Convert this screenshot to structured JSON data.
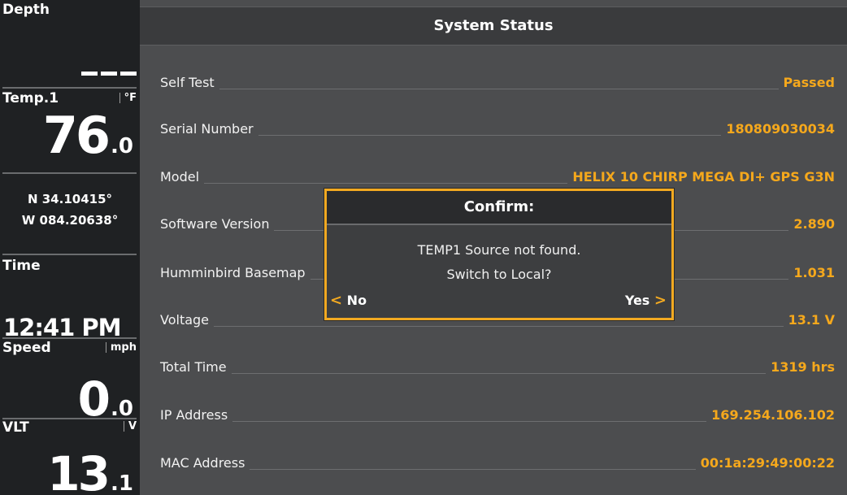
{
  "sidebar": {
    "depth": {
      "label": "Depth",
      "value": ""
    },
    "temp": {
      "label": "Temp.1",
      "unit": "°F",
      "value": "76",
      "decimal": "0"
    },
    "gps": {
      "lat": "N 34.10415°",
      "lon": "W 084.20638°"
    },
    "time": {
      "label": "Time",
      "value": "12:41 PM"
    },
    "speed": {
      "label": "Speed",
      "unit": "mph",
      "value": "0",
      "decimal": "0"
    },
    "vlt": {
      "label": "VLT",
      "unit": "V",
      "value": "13",
      "decimal": "1"
    }
  },
  "main": {
    "title": "System Status",
    "rows": [
      {
        "label": "Self Test",
        "value": "Passed"
      },
      {
        "label": "Serial Number",
        "value": "180809030034"
      },
      {
        "label": "Model",
        "value": "HELIX 10 CHIRP MEGA DI+ GPS G3N"
      },
      {
        "label": "Software Version",
        "value": "2.890"
      },
      {
        "label": "Humminbird Basemap",
        "value": "1.031"
      },
      {
        "label": "Voltage",
        "value": "13.1 V"
      },
      {
        "label": "Total Time",
        "value": "1319 hrs"
      },
      {
        "label": "IP Address",
        "value": "169.254.106.102"
      },
      {
        "label": "MAC Address",
        "value": "00:1a:29:49:00:22"
      }
    ]
  },
  "dialog": {
    "title": "Confirm:",
    "message_line1": "TEMP1 Source not found.",
    "message_line2": "Switch to Local?",
    "no_label": "No",
    "yes_label": "Yes"
  },
  "colors": {
    "accent": "#f5a81c",
    "panel_bg": "#4c4d4f",
    "sidebar_bg": "#1f2123",
    "title_bar_bg": "#3a3b3d"
  },
  "icons": {
    "no_chevron": "chevron-left-icon",
    "yes_chevron": "chevron-right-icon"
  }
}
